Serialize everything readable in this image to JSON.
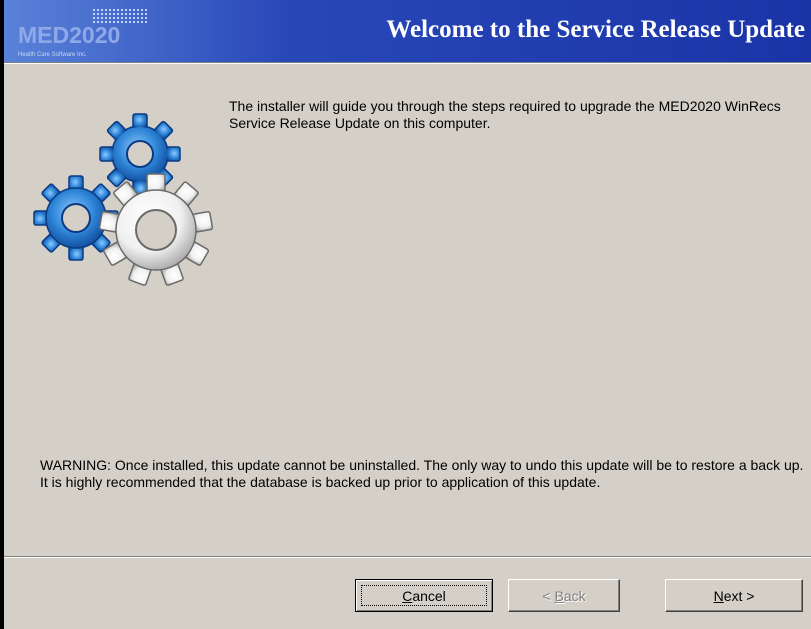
{
  "header": {
    "logo_text": "MED2020",
    "logo_tagline": "Health Care Software Inc.",
    "title": "Welcome to the Service Release Update"
  },
  "body": {
    "intro": "The installer will guide you through the steps required to upgrade the MED2020 WinRecs Service Release Update on this computer.",
    "warning": "WARNING: Once installed, this update cannot be uninstalled.  The only way to undo this update will be to restore a back up.  It is highly recommended that the database is backed up prior to application of this update."
  },
  "buttons": {
    "cancel_mnemonic": "C",
    "cancel_rest": "ancel",
    "back_prefix": "< ",
    "back_mnemonic": "B",
    "back_rest": "ack",
    "next_mnemonic": "N",
    "next_rest": "ext >"
  },
  "icons": {
    "gears": "gears-icon"
  },
  "colors": {
    "banner_dark": "#1a34a8",
    "banner_light": "#5a82d9",
    "gear_blue": "#2f86d8",
    "gear_white": "#f2f2f2",
    "dialog_bg": "#d4d0c8"
  }
}
